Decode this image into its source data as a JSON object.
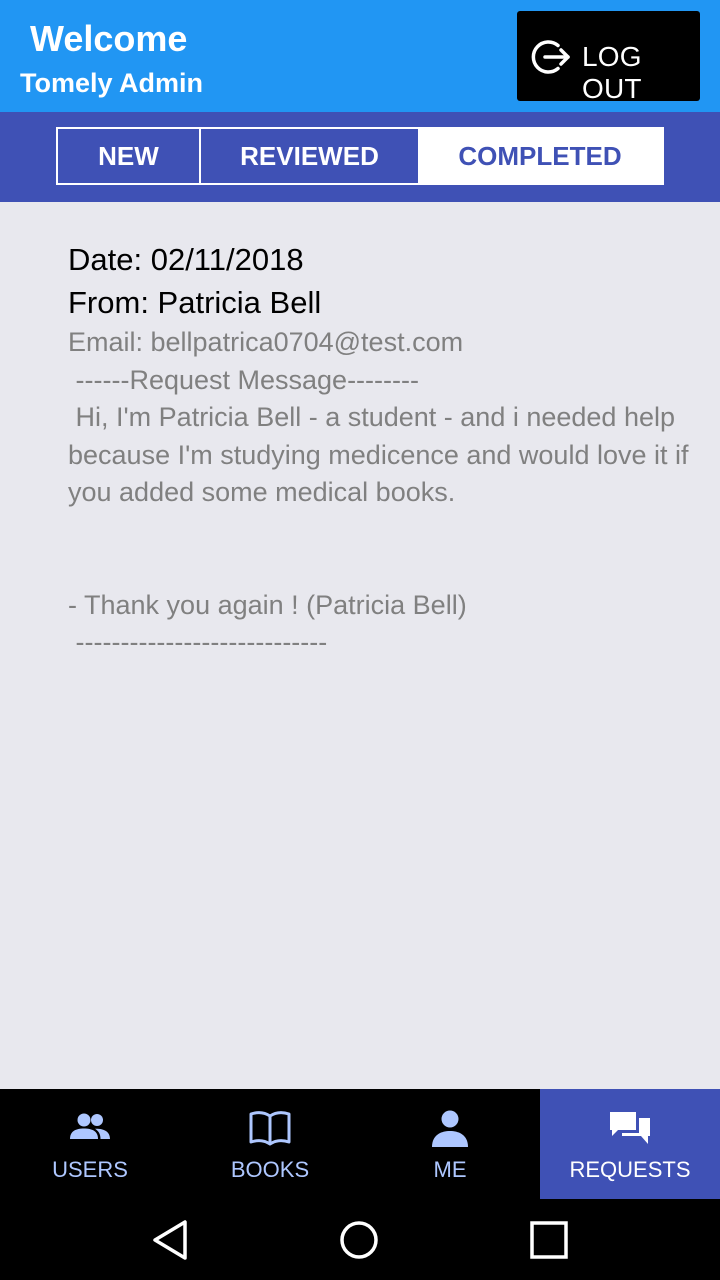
{
  "header": {
    "title": "Welcome",
    "subtitle": "Tomely Admin",
    "logout_label": "LOG OUT",
    "logout_icon": "logout-icon"
  },
  "tabs": [
    {
      "label": "NEW",
      "selected": false
    },
    {
      "label": "REVIEWED",
      "selected": false
    },
    {
      "label": "COMPLETED",
      "selected": true
    }
  ],
  "request": {
    "date": "Date: 02/11/2018",
    "from": "From: Patricia Bell",
    "email": "Email: bellpatrica0704@test.com",
    "message_header": " ------Request Message--------",
    "message_body": " Hi, I'm Patricia Bell - a student - and i needed help because I'm studying medicence and would love it if you added some medical books.\n\n\n- Thank you again ! (Patricia Bell)\n ----------------------------"
  },
  "bottom_nav": [
    {
      "label": "USERS",
      "icon": "users-icon",
      "active": false
    },
    {
      "label": "BOOKS",
      "icon": "book-icon",
      "active": false
    },
    {
      "label": "ME",
      "icon": "person-icon",
      "active": false
    },
    {
      "label": "REQUESTS",
      "icon": "chat-icon",
      "active": true
    }
  ],
  "colors": {
    "header_bg": "#2196f3",
    "primary": "#3f51b5",
    "nav_label": "#aec7ff",
    "body_bg": "#e8e8ee"
  }
}
